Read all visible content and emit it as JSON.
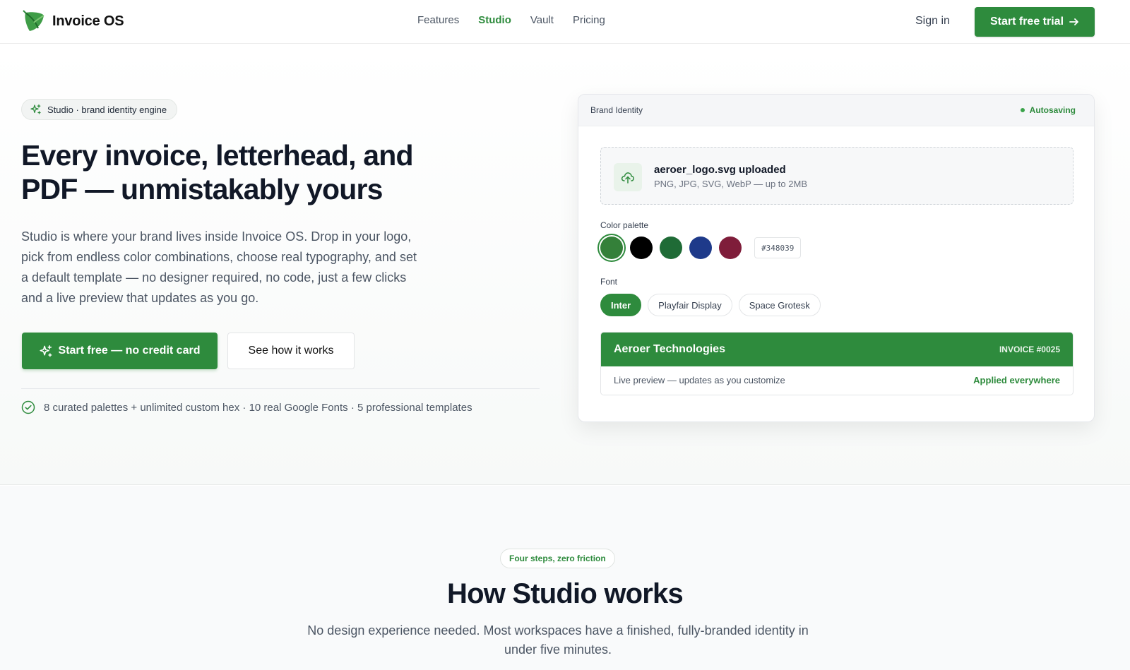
{
  "nav": {
    "brand_name": "Invoice OS",
    "links": [
      "Features",
      "Studio",
      "Vault",
      "Pricing"
    ],
    "active_link": "Studio",
    "signin_label": "Sign in",
    "trial_label": "Start free trial"
  },
  "hero": {
    "badge": "Studio · brand identity engine",
    "title_line1": "Every invoice, letterhead, and",
    "title_line2": "PDF — unmistakably yours",
    "description": "Studio is where your brand lives inside Invoice OS. Drop in your logo, pick from endless color combinations, choose real typography, and set a default template — no designer required, no code, just a few clicks and a live preview that updates as you go.",
    "cta_primary": "Start free — no credit card",
    "cta_secondary": "See how it works",
    "features_line": "8 curated palettes + unlimited custom hex · 10 real Google Fonts · 5 professional templates"
  },
  "brand_card": {
    "title": "Brand Identity",
    "status": "Autosaving",
    "upload": {
      "file": "aeroer_logo.svg uploaded",
      "hint": "PNG, JPG, SVG, WebP — up to 2MB"
    },
    "palette_label": "Color palette",
    "palette": [
      "#348039",
      "#000000",
      "#1f6b36",
      "#1e3a8a",
      "#7f1d3a"
    ],
    "selected_color": "#348039",
    "hex_value": "#348039",
    "font_label": "Font",
    "fonts": [
      "Inter",
      "Playfair Display",
      "Space Grotesk"
    ],
    "selected_font": "Inter",
    "preview": {
      "company": "Aeroer Technologies",
      "invoice": "INVOICE #0025",
      "live_text": "Live preview — updates as you customize",
      "applied": "Applied everywhere"
    }
  },
  "how": {
    "pill": "Four steps, zero friction",
    "title": "How Studio works",
    "description": "No design experience needed. Most workspaces have a finished, fully-branded identity in under five minutes."
  },
  "colors": {
    "accent": "#2e8b3d",
    "text_dark": "#111827",
    "text_muted": "#4b5563"
  }
}
